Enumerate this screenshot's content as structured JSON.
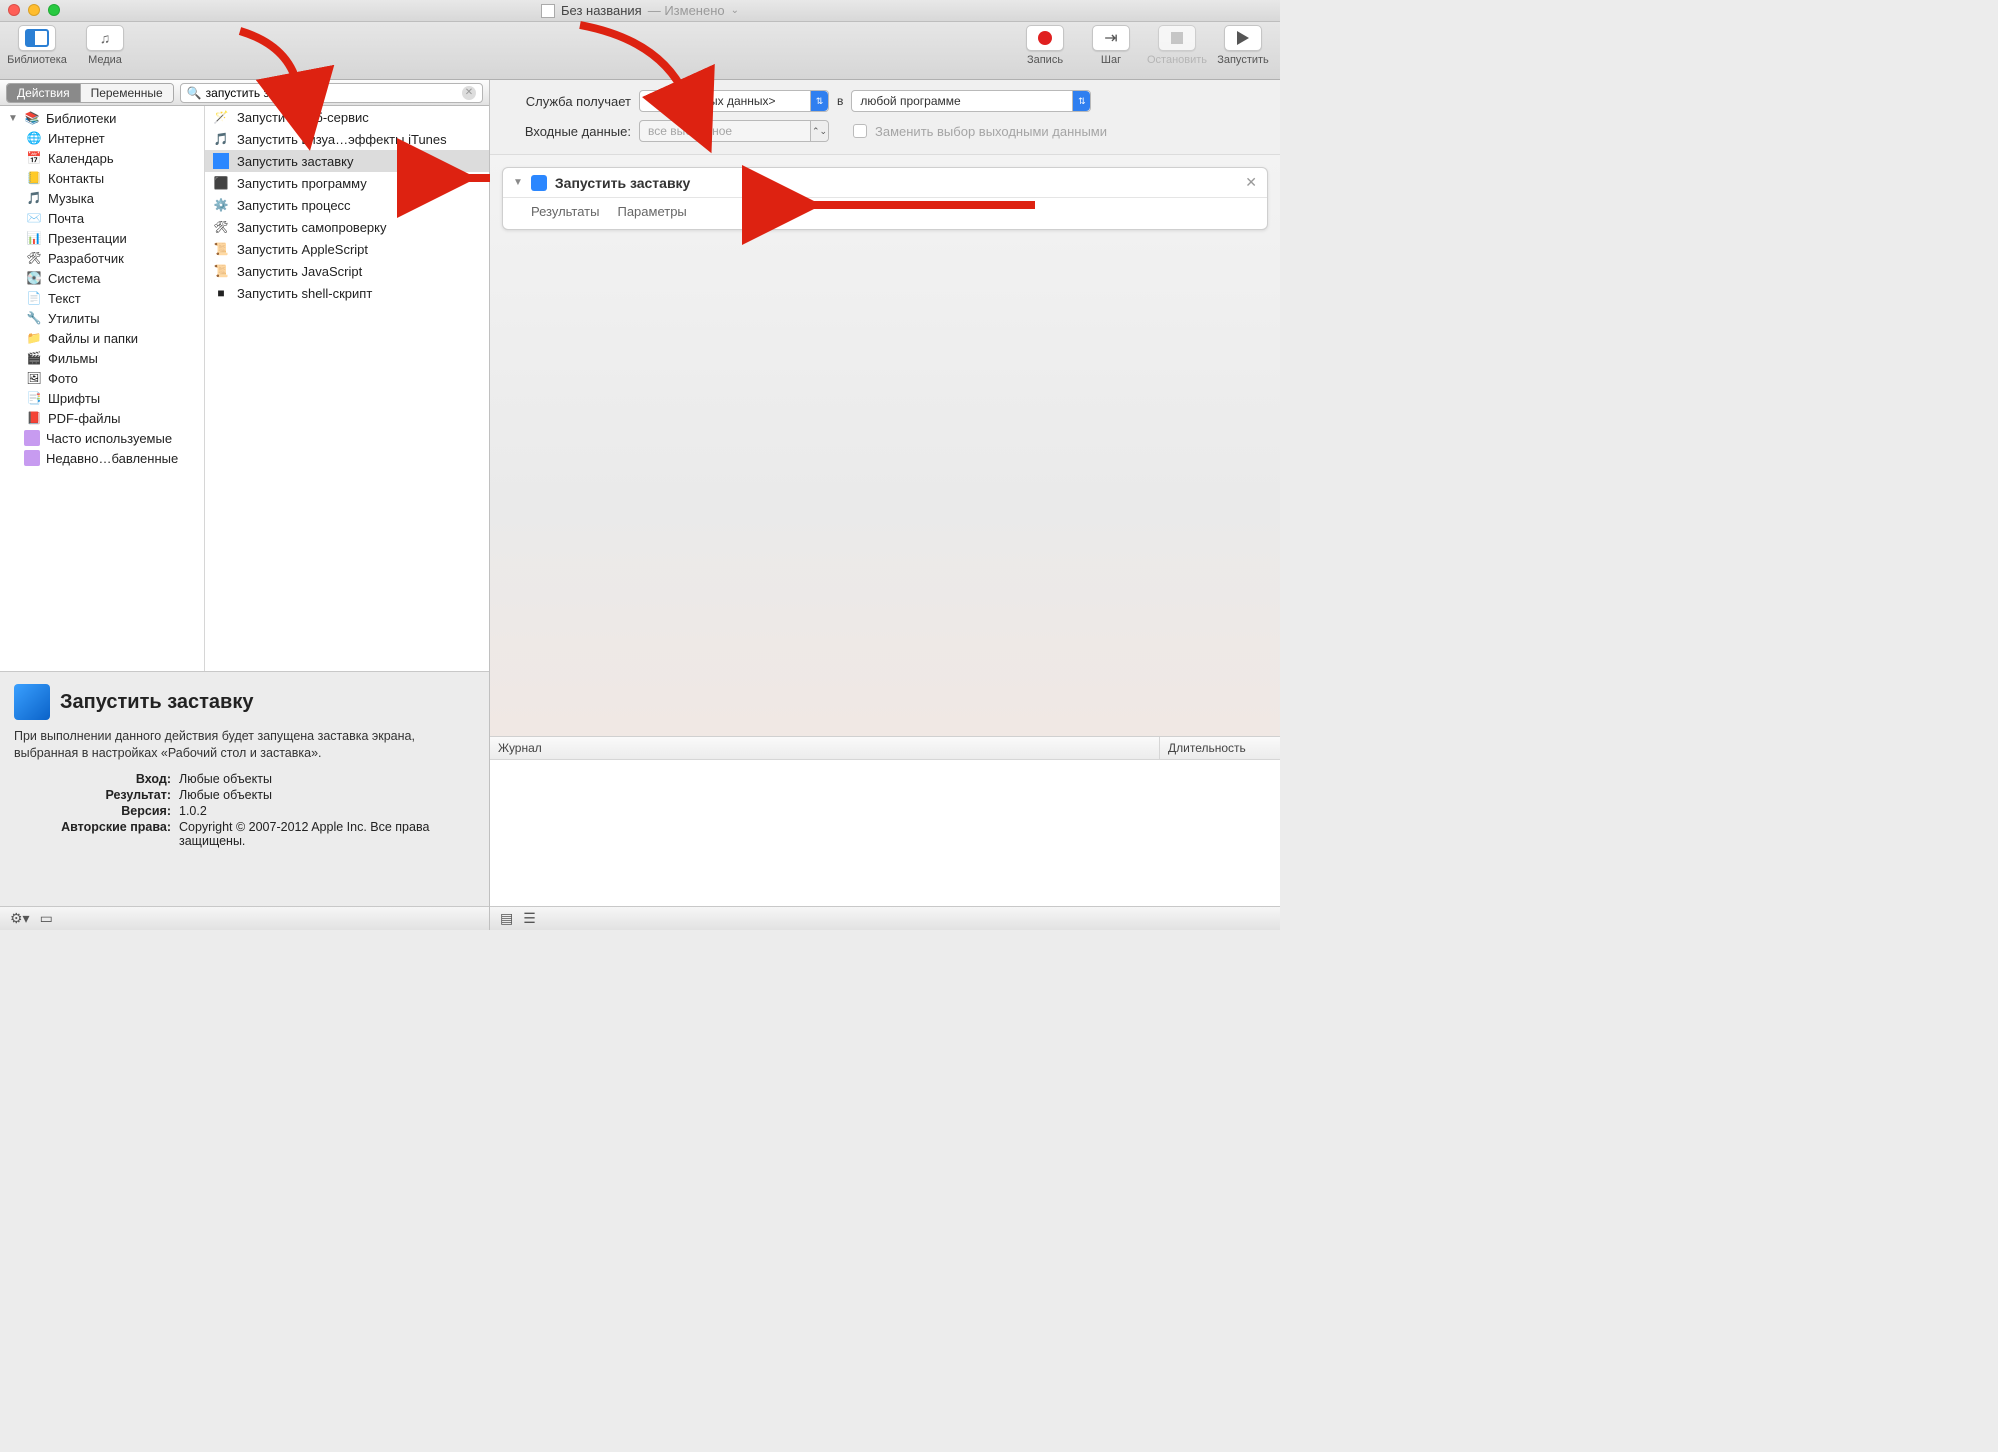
{
  "title": {
    "name": "Без названия",
    "status": "— Изменено"
  },
  "toolbar": {
    "library": "Библиотека",
    "media": "Медиа",
    "record": "Запись",
    "step": "Шаг",
    "stop": "Остановить",
    "run": "Запустить"
  },
  "segments": {
    "actions": "Действия",
    "variables": "Переменные"
  },
  "search": {
    "value": "запустить за"
  },
  "tree": {
    "root": "Библиотеки",
    "items": [
      "Интернет",
      "Календарь",
      "Контакты",
      "Музыка",
      "Почта",
      "Презентации",
      "Разработчик",
      "Система",
      "Текст",
      "Утилиты",
      "Файлы и папки",
      "Фильмы",
      "Фото",
      "Шрифты",
      "PDF-файлы"
    ],
    "smart": [
      "Часто используемые",
      "Недавно…бавленные"
    ]
  },
  "results": [
    "Запустить веб-сервис",
    "Запустить визуа…эффекты iTunes",
    "Запустить заставку",
    "Запустить программу",
    "Запустить процесс",
    "Запустить самопроверку",
    "Запустить AppleScript",
    "Запустить JavaScript",
    "Запустить shell-скрипт"
  ],
  "selected_index": 2,
  "info": {
    "title": "Запустить заставку",
    "desc": "При выполнении данного действия будет запущена заставка экрана, выбранная в настройках «Рабочий стол и заставка».",
    "input_k": "Вход:",
    "input_v": "Любые объекты",
    "result_k": "Результат:",
    "result_v": "Любые объекты",
    "version_k": "Версия:",
    "version_v": "1.0.2",
    "copyright_k": "Авторские права:",
    "copyright_v": "Copyright © 2007-2012 Apple Inc. Все права защищены."
  },
  "right": {
    "service_label": "Служба получает",
    "service_value": "<нет входных данных>",
    "in_word": "в",
    "app_value": "любой программе",
    "input_label": "Входные данные:",
    "input_value": "все выбранное",
    "replace_label": "Заменить выбор выходными данными"
  },
  "wf": {
    "title": "Запустить заставку",
    "tab_results": "Результаты",
    "tab_params": "Параметры"
  },
  "log": {
    "col1": "Журнал",
    "col2": "Длительность"
  }
}
